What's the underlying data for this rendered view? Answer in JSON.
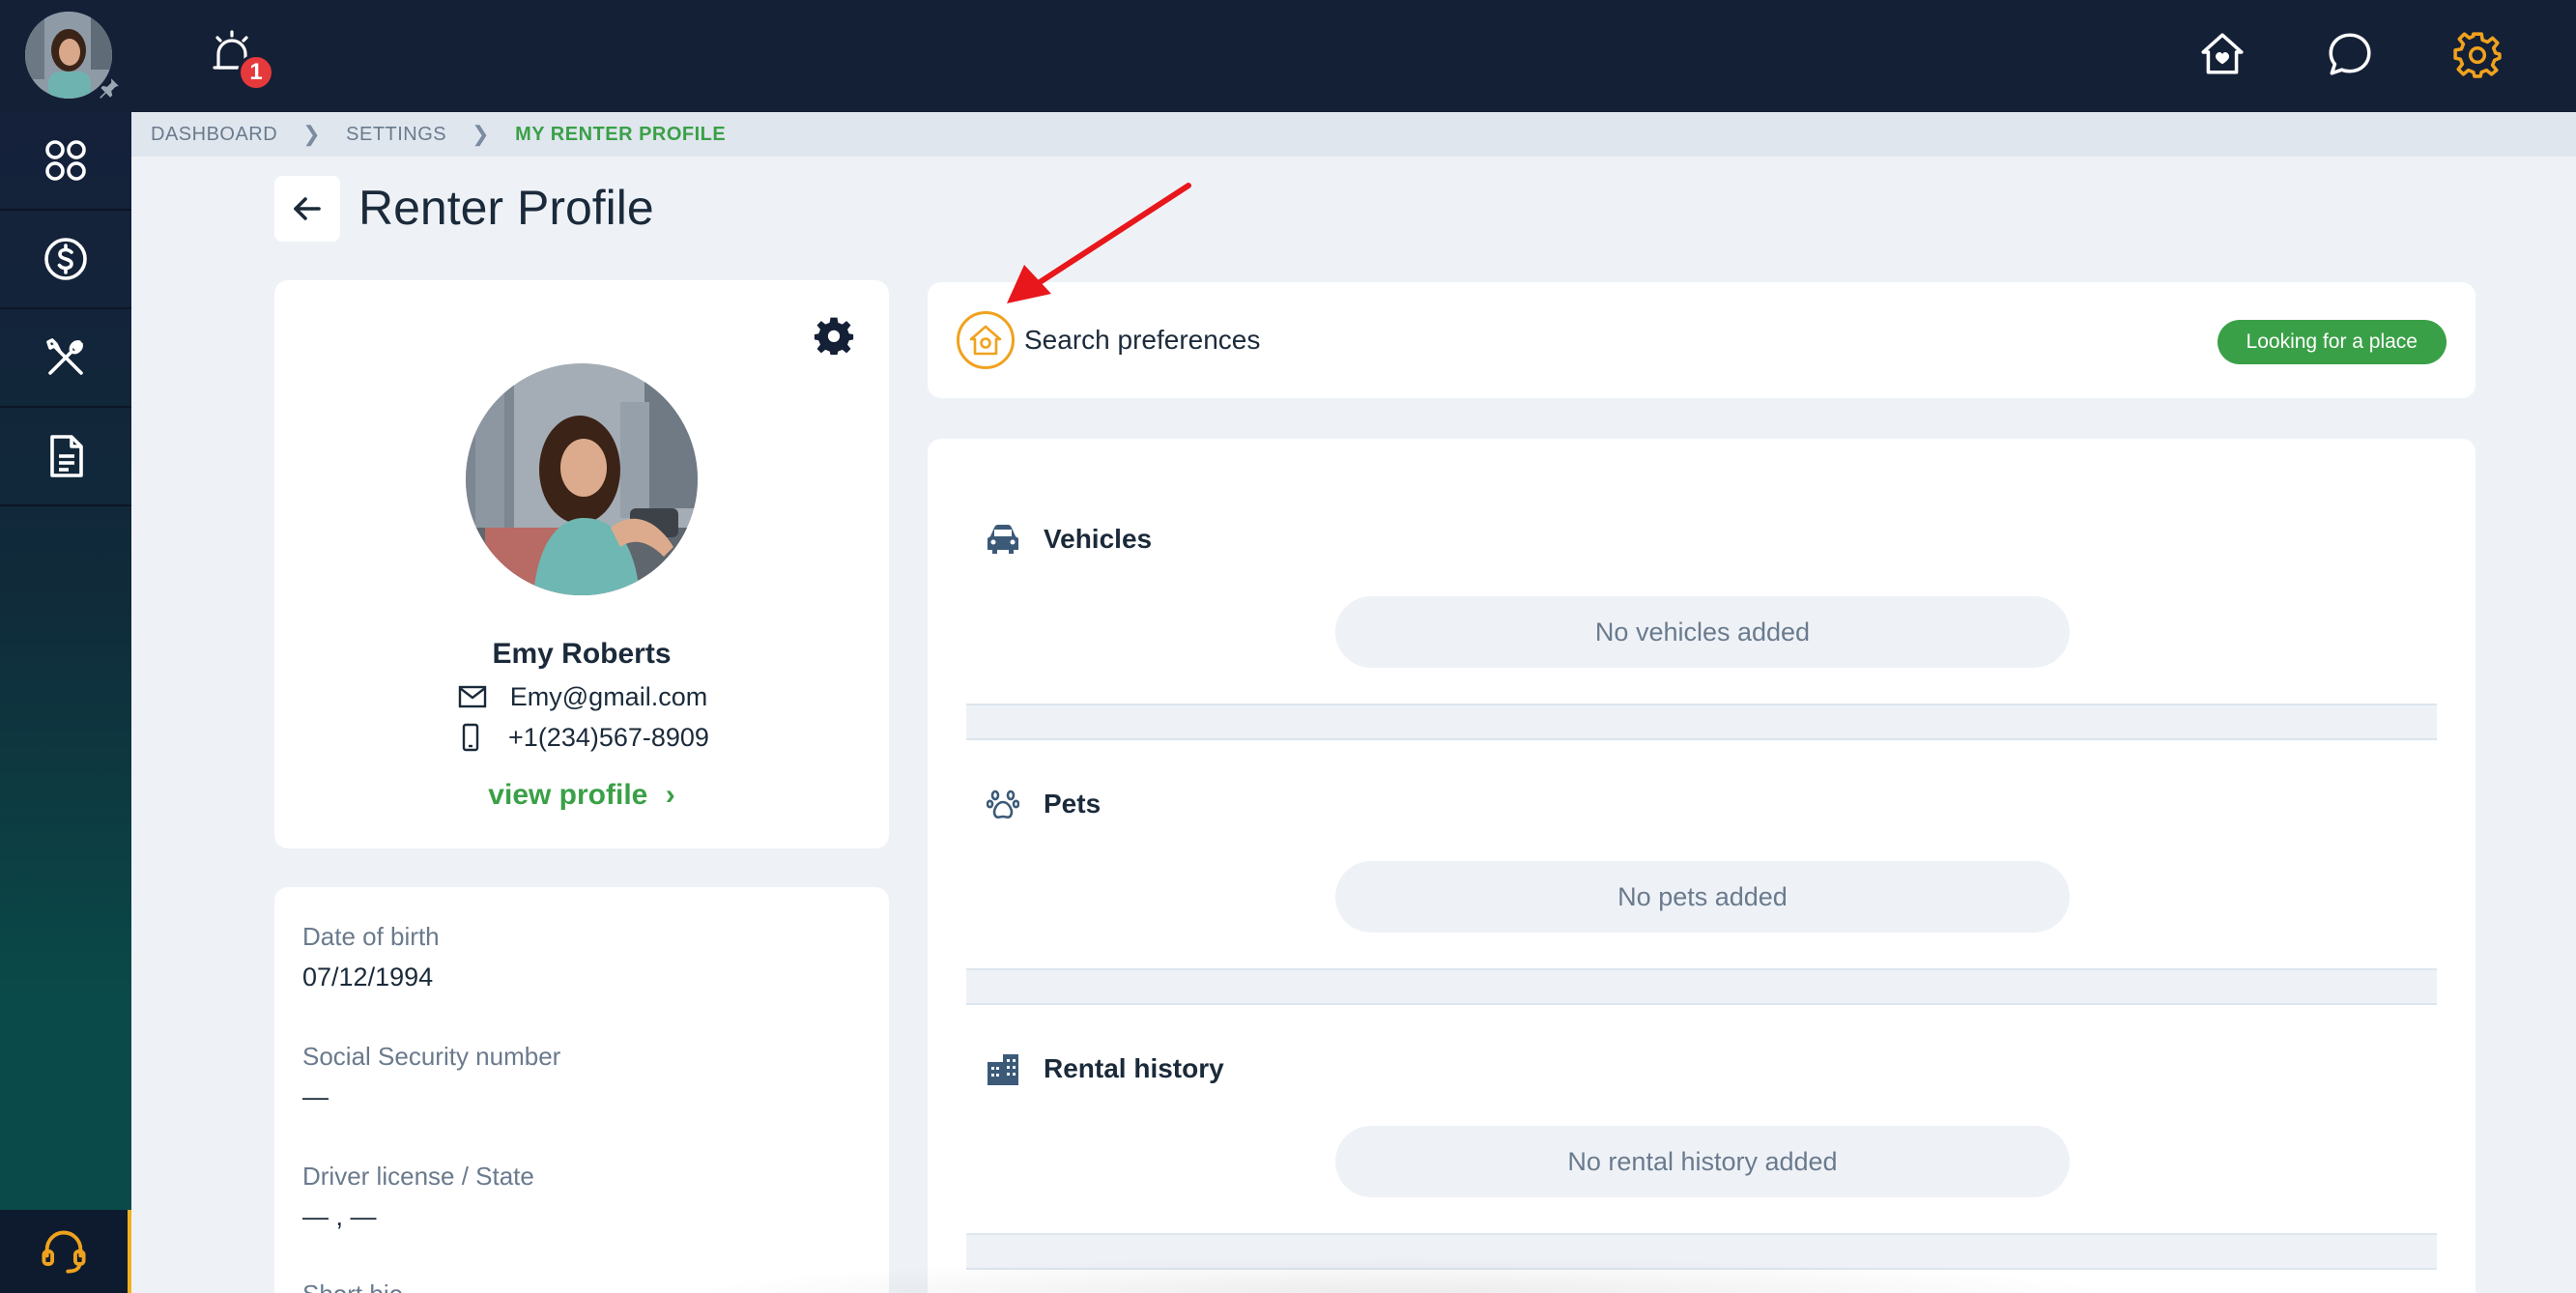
{
  "topbar": {
    "notifications_count": "1",
    "icons": [
      "avatar",
      "pin-icon",
      "alarm-icon",
      "home-heart-icon",
      "chat-icon",
      "gear-icon"
    ],
    "accent_color": "#f0a21e"
  },
  "sidebar": {
    "items": [
      {
        "icon": "dashboard-grid-icon"
      },
      {
        "icon": "dollar-icon"
      },
      {
        "icon": "tools-icon"
      },
      {
        "icon": "document-icon"
      }
    ],
    "support_icon": "headset-icon"
  },
  "breadcrumb": {
    "items": [
      "DASHBOARD",
      "SETTINGS",
      "MY RENTER PROFILE"
    ]
  },
  "page": {
    "title": "Renter Profile"
  },
  "profile": {
    "name": "Emy Roberts",
    "email": "Emy@gmail.com",
    "phone": "+1(234)567-8909",
    "view_profile_label": "view profile"
  },
  "details": {
    "dob_label": "Date of birth",
    "dob_value": "07/12/1994",
    "ssn_label": "Social Security number",
    "ssn_value": "—",
    "license_label": "Driver license / State",
    "license_value": "— , —",
    "bio_label": "Short bio"
  },
  "search_preferences": {
    "title": "Search preferences",
    "status": "Looking for a place",
    "status_color": "#3aa047"
  },
  "sections": [
    {
      "title": "Vehicles",
      "empty": "No vehicles added",
      "icon": "car-icon"
    },
    {
      "title": "Pets",
      "empty": "No pets added",
      "icon": "paw-icon"
    },
    {
      "title": "Rental history",
      "empty": "No rental history added",
      "icon": "building-icon"
    }
  ]
}
